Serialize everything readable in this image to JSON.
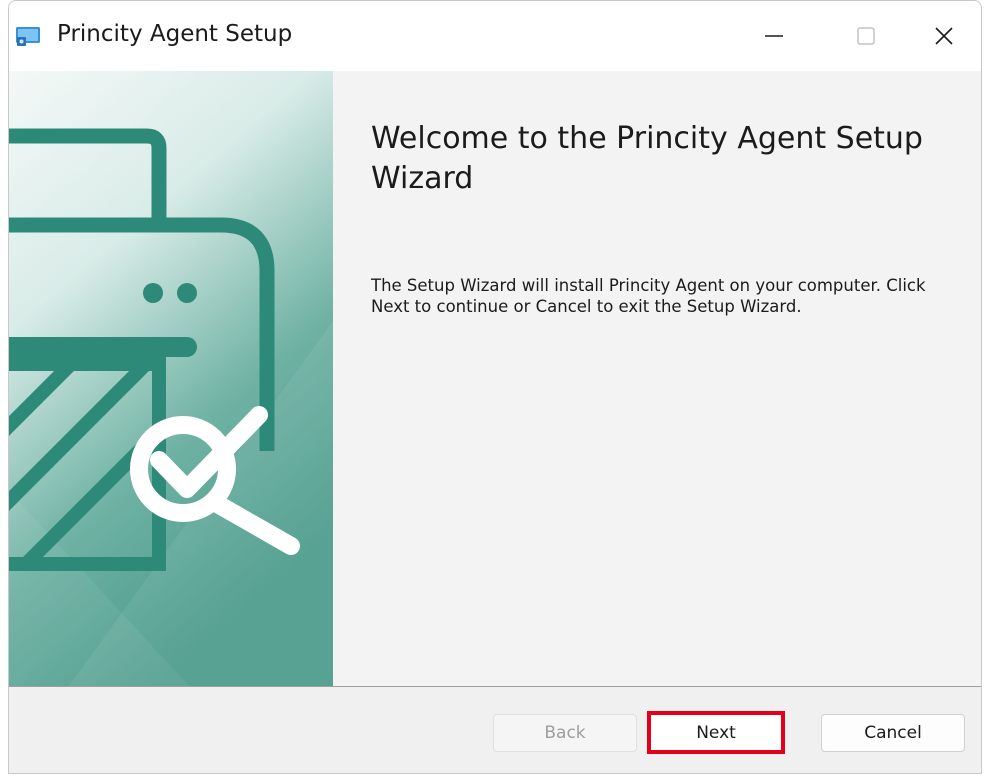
{
  "window": {
    "title": "Princity Agent Setup"
  },
  "controls": {
    "minimize_icon": "minimize-icon",
    "maximize_icon": "maximize-icon",
    "close_icon": "close-icon"
  },
  "welcome": {
    "title": "Welcome to the Princity Agent Setup Wizard",
    "body": "The Setup Wizard will install Princity Agent on your computer. Click Next to continue or Cancel to exit the Setup Wizard."
  },
  "buttons": {
    "back": "Back",
    "next": "Next",
    "cancel": "Cancel"
  },
  "colors": {
    "accent_teal": "#2e8a78",
    "highlight_red": "#e5001a"
  }
}
